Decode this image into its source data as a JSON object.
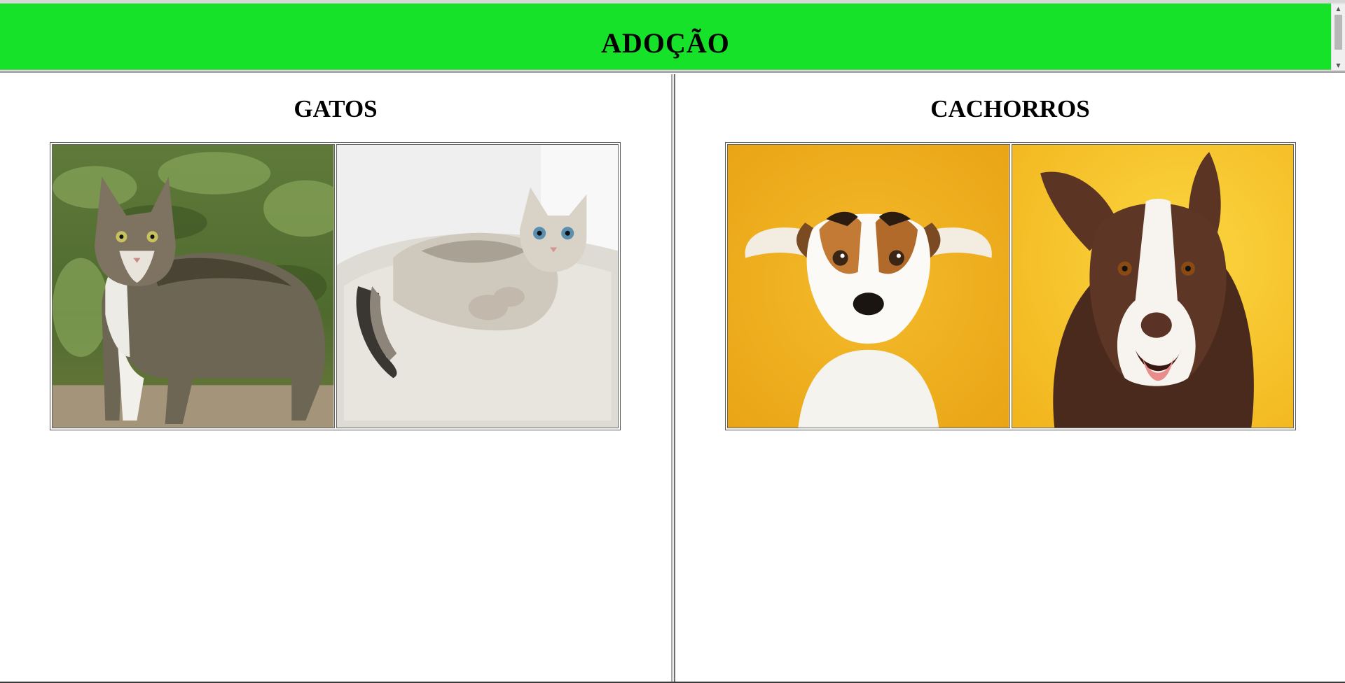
{
  "header": {
    "title": "ADOÇÃO"
  },
  "sections": {
    "left": {
      "title": "GATOS"
    },
    "right": {
      "title": "CACHORROS"
    }
  },
  "icons": {
    "scroll_up": "scroll-up-arrow",
    "scroll_down": "scroll-down-arrow"
  },
  "colors": {
    "header_bg": "#16e22a",
    "dog_bg": "#f2b51e"
  }
}
